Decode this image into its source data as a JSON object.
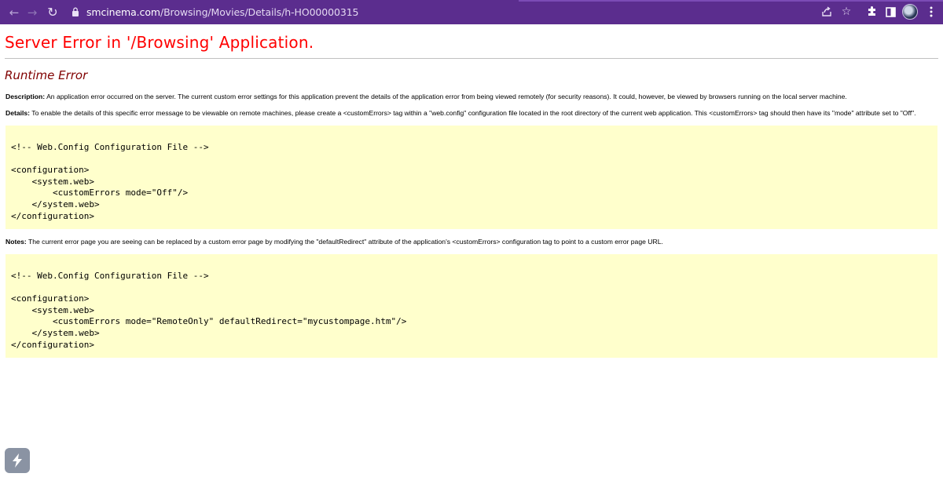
{
  "browser": {
    "back_icon": "arrow-left-icon",
    "forward_icon": "arrow-right-icon",
    "reload_icon": "reload-icon",
    "url_domain": "smcinema.com",
    "url_path": "/Browsing/Movies/Details/h-HO00000315",
    "colors": {
      "toolbar": "#5b2d8e"
    }
  },
  "page": {
    "title": "Server Error in '/Browsing' Application.",
    "subtitle": "Runtime Error",
    "description_label": "Description:",
    "description_text": "An application error occurred on the server. The current custom error settings for this application prevent the details of the application error from being viewed remotely (for security reasons). It could, however, be viewed by browsers running on the local server machine.",
    "details_label": "Details:",
    "details_text": "To enable the details of this specific error message to be viewable on remote machines, please create a <customErrors> tag within a \"web.config\" configuration file located in the root directory of the current web application. This <customErrors> tag should then have its \"mode\" attribute set to \"Off\".",
    "code1": "<!-- Web.Config Configuration File -->\n\n<configuration>\n    <system.web>\n        <customErrors mode=\"Off\"/>\n    </system.web>\n</configuration>",
    "notes_label": "Notes:",
    "notes_text": "The current error page you are seeing can be replaced by a custom error page by modifying the \"defaultRedirect\" attribute of the application's <customErrors> configuration tag to point to a custom error page URL.",
    "code2": "<!-- Web.Config Configuration File -->\n\n<configuration>\n    <system.web>\n        <customErrors mode=\"RemoteOnly\" defaultRedirect=\"mycustompage.htm\"/>\n    </system.web>\n</configuration>",
    "colors": {
      "title": "#ff0000",
      "subtitle": "#800000",
      "code_bg": "#ffffcc"
    }
  }
}
